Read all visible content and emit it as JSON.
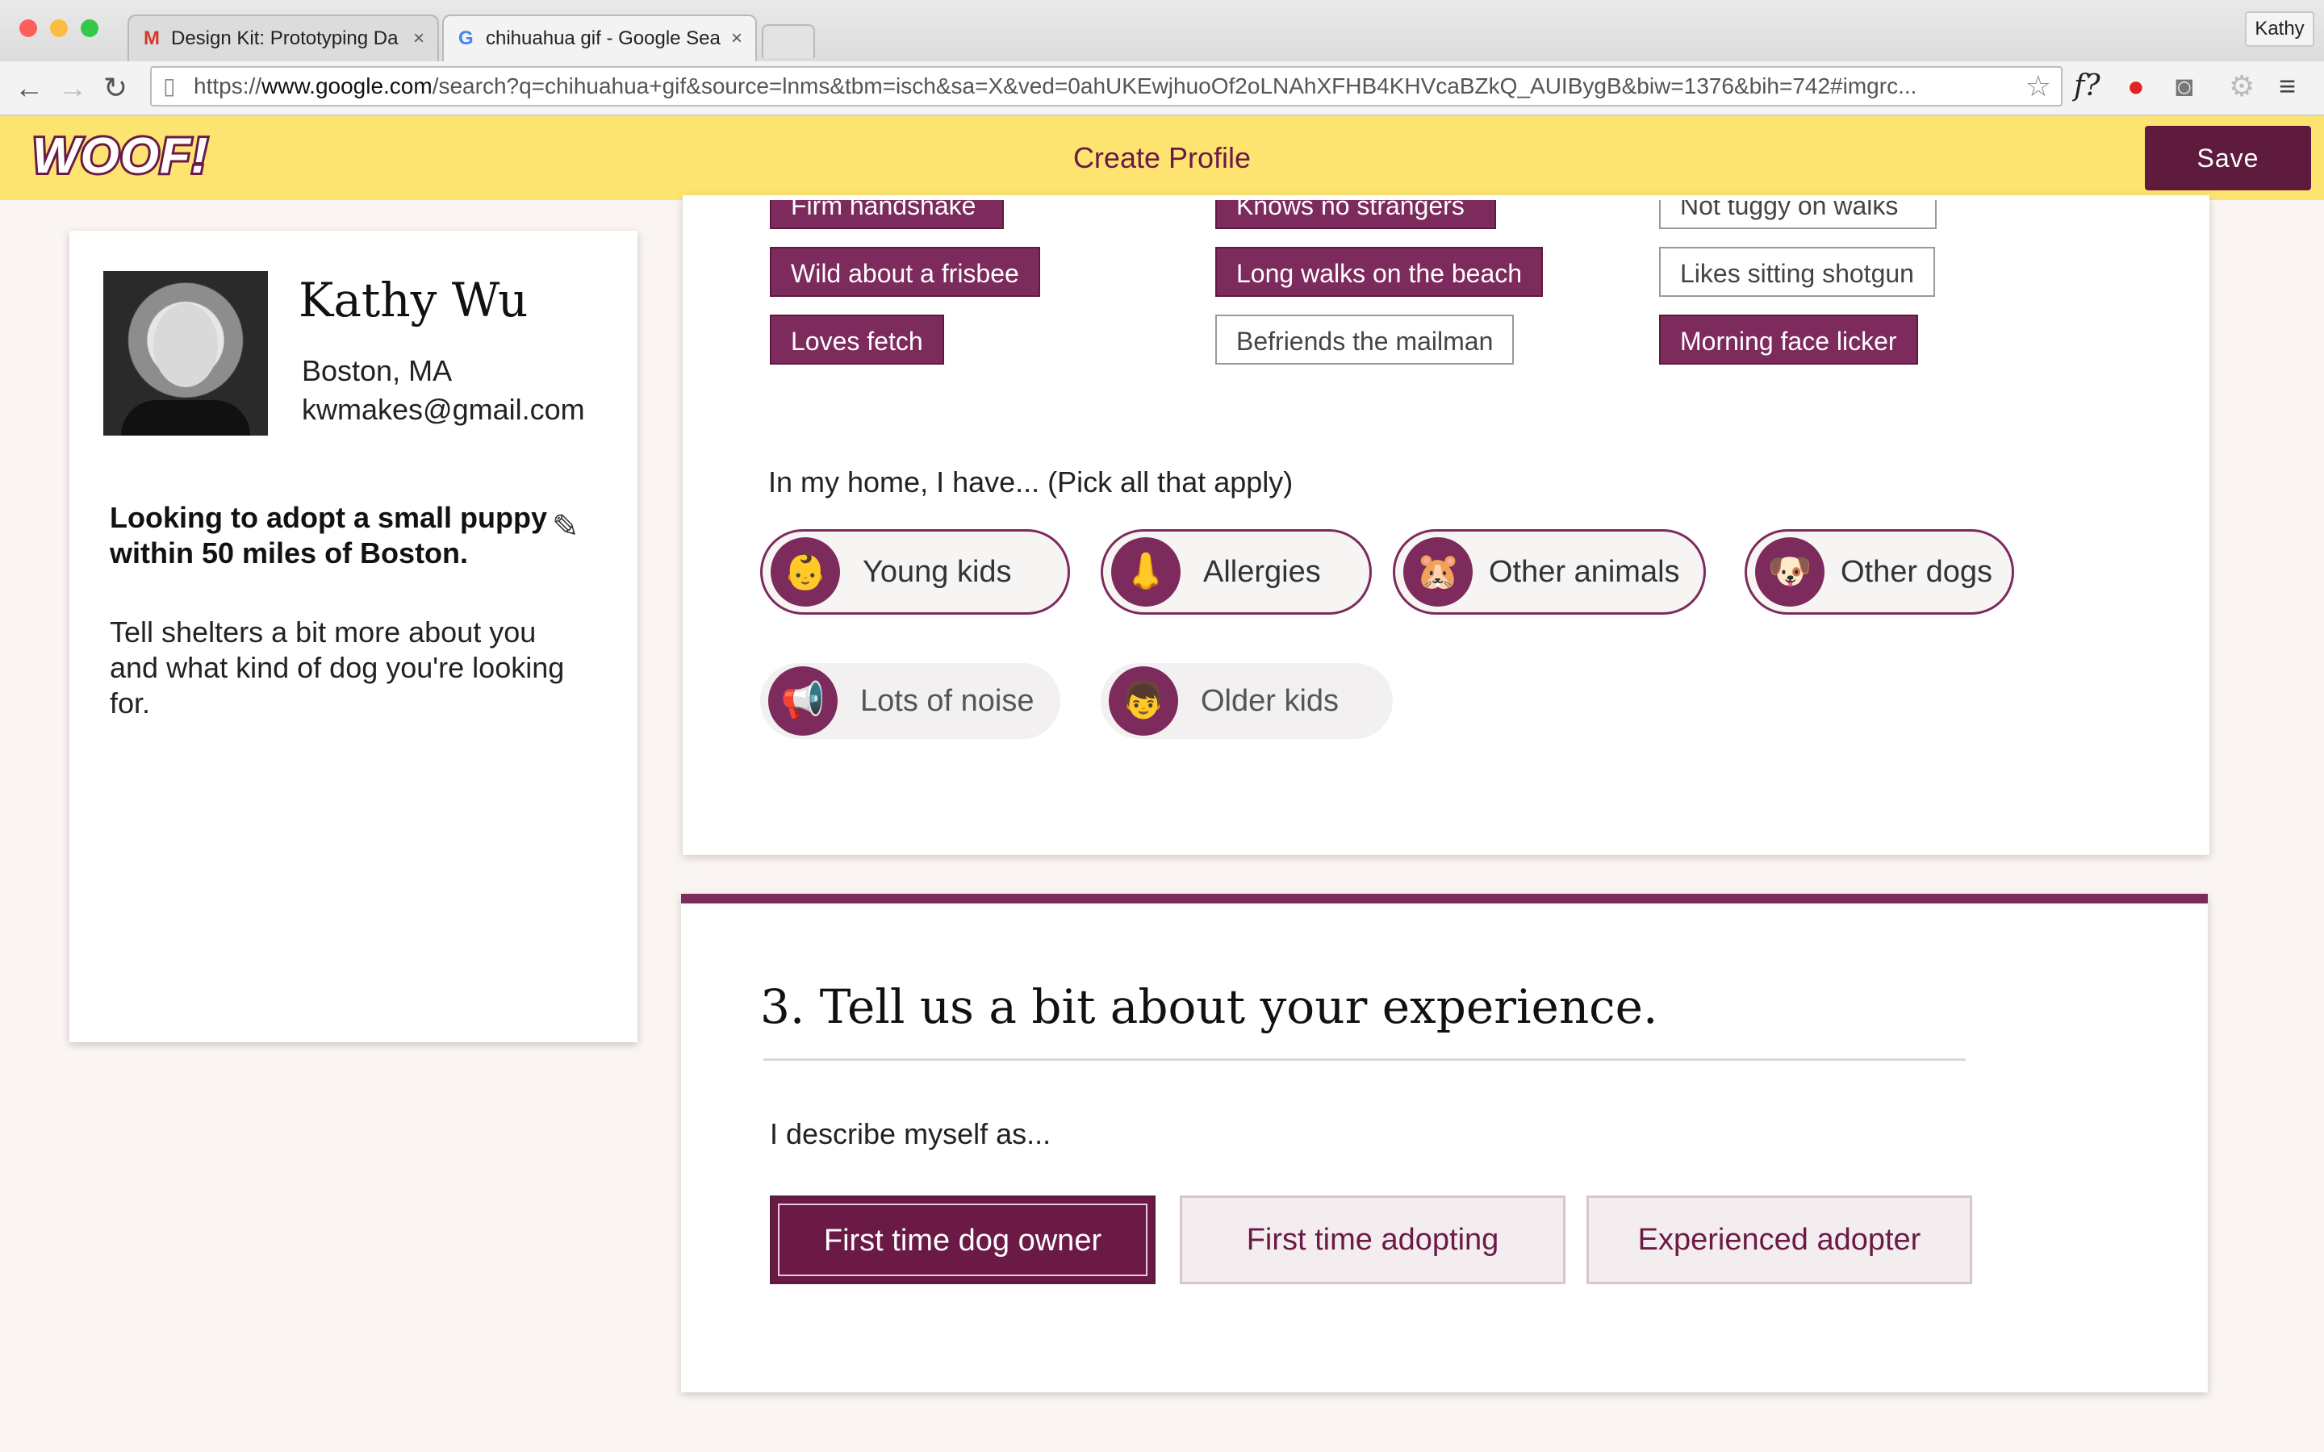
{
  "browser": {
    "tabs": [
      {
        "icon": "M",
        "title": "Design Kit: Prototyping Da",
        "close": "×"
      },
      {
        "icon": "G",
        "title": "chihuahua gif - Google Sea",
        "close": "×"
      }
    ],
    "profile": "Kathy",
    "url_scheme": "https://",
    "url_host": "www.google.com",
    "url_path": "/search?q=chihuahua+gif&source=lnms&tbm=isch&sa=X&ved=0ahUKEwjhuoOf2oLNAhXFHB4KHVcaBZkQ_AUIBygB&biw=1376&bih=742#imgrc...",
    "ext_formula": "f?"
  },
  "app": {
    "logo": "WOOF!",
    "title": "Create Profile",
    "save_label": "Save"
  },
  "profile": {
    "name": "Kathy Wu",
    "location": "Boston, MA",
    "email": "kwmakes@gmail.com",
    "goal": "Looking to adopt a small puppy within 50 miles of Boston.",
    "prompt": "Tell shelters a bit more about you and what kind of dog you're looking for."
  },
  "traits": {
    "row0": [
      "Firm handshake",
      "Knows no strangers",
      "Not tuggy on walks"
    ],
    "row1": [
      "Wild about a frisbee",
      "Long walks on the beach",
      "Likes sitting shotgun"
    ],
    "row2": [
      "Loves fetch",
      "Befriends the mailman",
      "Morning face licker"
    ]
  },
  "home": {
    "prompt": "In my home, I have... (Pick all that apply)",
    "options": [
      {
        "label": "Young kids",
        "emoji": "👶"
      },
      {
        "label": "Allergies",
        "emoji": "👃"
      },
      {
        "label": "Other animals",
        "emoji": "🐹"
      },
      {
        "label": "Other dogs",
        "emoji": "🐶"
      },
      {
        "label": "Lots of noise",
        "emoji": "📢"
      },
      {
        "label": "Older kids",
        "emoji": "👦"
      }
    ]
  },
  "experience": {
    "title": "3. Tell us a bit about your experience.",
    "prompt": "I describe myself as...",
    "options": [
      "First time dog owner",
      "First time adopting",
      "Experienced adopter"
    ]
  },
  "colors": {
    "brand": "#6b1a46",
    "accent": "#7d2a5c",
    "header": "#fde471"
  }
}
